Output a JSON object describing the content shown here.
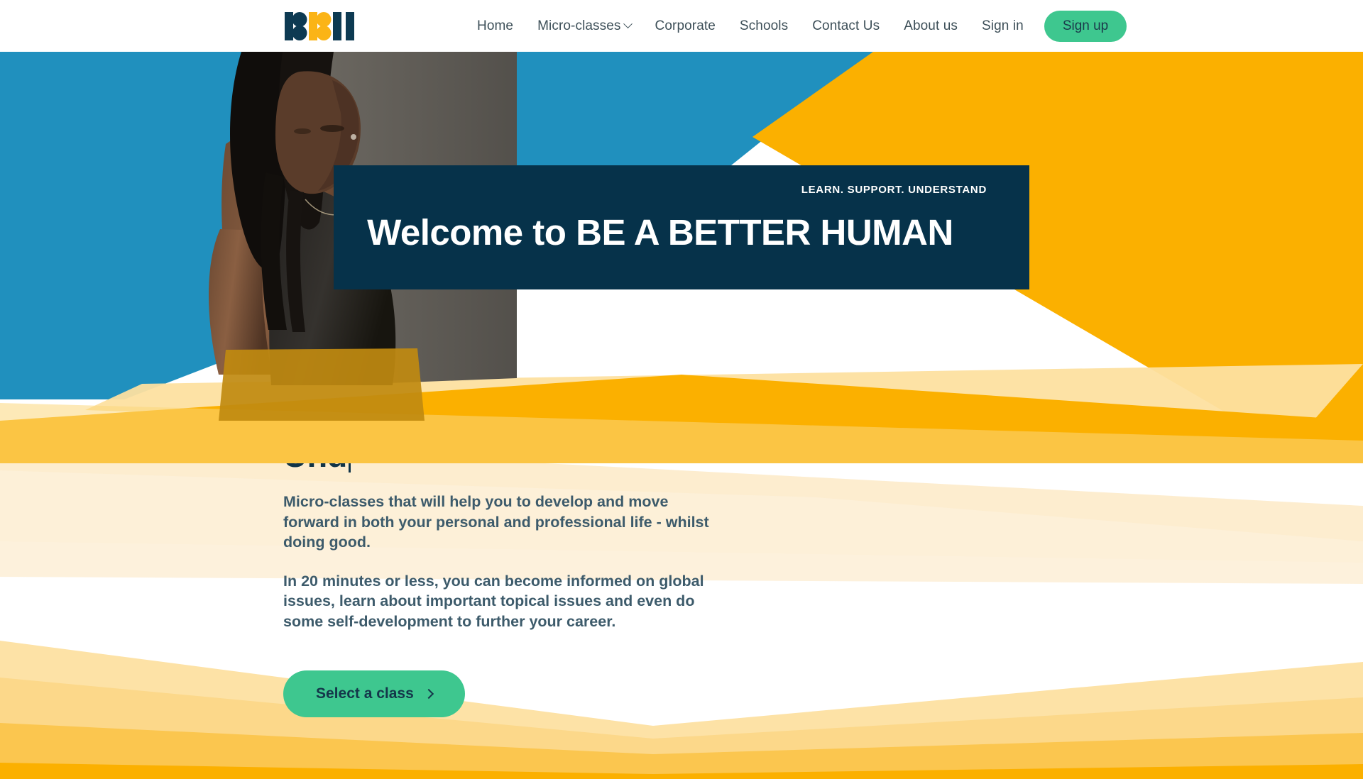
{
  "brand": {
    "name": "BE A BETTER HUMAN",
    "logo_icon": "bbh-logo-icon",
    "navy": "#06324a",
    "yellow": "#fbb000",
    "blue": "#2090be",
    "green": "#3ec78f",
    "cream": "#fce9bb"
  },
  "nav": {
    "items": [
      {
        "label": "Home",
        "icon": null
      },
      {
        "label": "Micro-classes",
        "icon": "chevron-down-icon"
      },
      {
        "label": "Corporate",
        "icon": null
      },
      {
        "label": "Schools",
        "icon": null
      },
      {
        "label": "Contact Us",
        "icon": null
      },
      {
        "label": "About us",
        "icon": null
      },
      {
        "label": "Sign in",
        "icon": null
      }
    ],
    "signup_label": "Sign up"
  },
  "hero": {
    "kicker": "LEARN. SUPPORT. UNDERSTAND",
    "title": "Welcome to BE A BETTER HUMAN",
    "photo_alt": "woman-portrait-photo"
  },
  "main": {
    "heading": "Und",
    "paragraph_1": "Micro-classes that will help you to develop and move forward in both your personal and professional life - whilst doing good.",
    "paragraph_2": "In 20 minutes or less, you can become informed on global issues, learn about important topical issues and even do some self-development to further your career.",
    "cta_label": "Select a class",
    "cta_icon": "chevron-right-icon"
  }
}
